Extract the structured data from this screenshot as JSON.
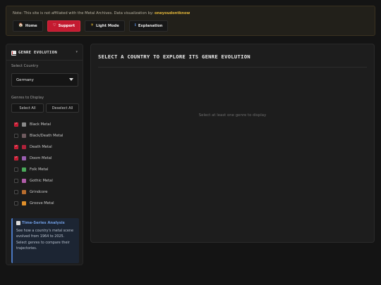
{
  "banner": {
    "note": "Note: This site is not affiliated with the Metal Archives. Data visualization by:",
    "author": "oneyoudontknow",
    "nav": [
      {
        "label": "Home",
        "icon": "🏠",
        "icon_name": "home-icon"
      },
      {
        "label": "Support",
        "icon": "♡",
        "icon_name": "heart-icon"
      },
      {
        "label": "Light Mode",
        "icon": "☀",
        "icon_name": "sun-icon"
      },
      {
        "label": "Explanation",
        "icon": "ℹ",
        "icon_name": "info-icon"
      }
    ]
  },
  "sidebar": {
    "title": "GENRE EVOLUTION",
    "title_icon": "chart-icon",
    "collapse_icon": "▾",
    "country_label": "Select Country",
    "country_value": "Germany",
    "genres_label": "Genres to Display",
    "select_all": "Select All",
    "deselect_all": "Deselect All",
    "genres": [
      {
        "name": "Black Metal",
        "checked": true,
        "color": "#8a8a8a"
      },
      {
        "name": "Black/Death Metal",
        "checked": false,
        "color": "#6e5a5e"
      },
      {
        "name": "Death Metal",
        "checked": true,
        "color": "#b0223a"
      },
      {
        "name": "Doom Metal",
        "checked": true,
        "color": "#9a5fb0"
      },
      {
        "name": "Folk Metal",
        "checked": false,
        "color": "#4aa85a"
      },
      {
        "name": "Gothic Metal",
        "checked": false,
        "color": "#b05ca8"
      },
      {
        "name": "Grindcore",
        "checked": false,
        "color": "#b86d2e"
      },
      {
        "name": "Groove Metal",
        "checked": false,
        "color": "#e0902a"
      },
      {
        "name": "Heavy Metal",
        "checked": true,
        "color": "#c0c0c0"
      }
    ],
    "info": {
      "title": "Time-Series Analysis",
      "text": "See how a country's metal scene evolved from 1964 to 2025. Select genres to compare their trajectories."
    }
  },
  "main": {
    "title": "SELECT A COUNTRY TO EXPLORE ITS GENRE EVOLUTION",
    "empty_message": "Select at least one genre to display"
  },
  "colors": {
    "accent_red": "#c41a30",
    "author_gold": "#e0b43a",
    "info_blue": "#6f9be0"
  }
}
